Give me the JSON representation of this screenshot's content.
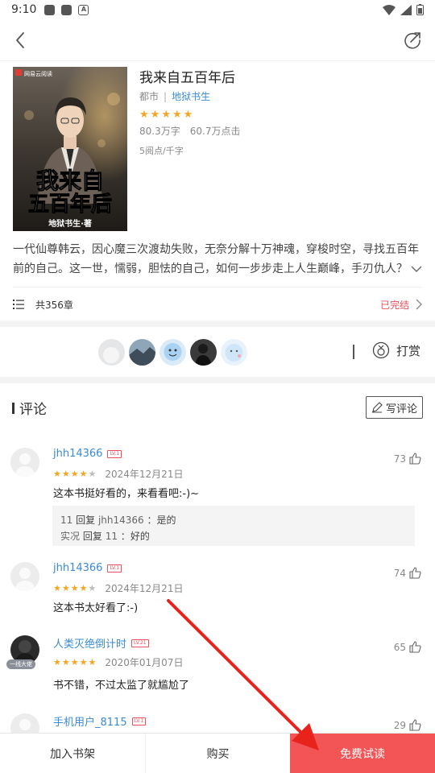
{
  "status_bar": {
    "time": "9:10"
  },
  "book": {
    "title": "我来自五百年后",
    "category": "都市",
    "author": "地狱书生",
    "rating_stars": 5,
    "word_count": "80.3万字",
    "clicks": "60.7万点击",
    "price": "5阅点/千字",
    "cover": {
      "publisher": "网易云阅读",
      "title_line1": "我来自",
      "title_line2": "五百年后",
      "author_credit": "地狱书生·著"
    },
    "intro": "一代仙尊韩云，因心魔三次渡劫失败，无奈分解十万神魂，穿梭时空，寻找五百年前的自己。这一世，懦弱，胆怯的自己，如何一步步走上人生巅峰，手刃仇人？",
    "chapters": "共356章",
    "status": "已完结"
  },
  "rewards": {
    "label": "打赏"
  },
  "comments_section": {
    "title": "评论",
    "write_label": "写评论",
    "items": [
      {
        "user": "jhh14366",
        "level": "LV.1",
        "stars": 4,
        "date": "2024年12月21日",
        "text": "这本书挺好看的，来看看吧:-)~",
        "likes": "73",
        "replies": [
          {
            "from": "11",
            "verb": "回复",
            "to": "jhh14366",
            "text": "是的"
          },
          {
            "from": "实况",
            "verb": "回复",
            "to": "11",
            "text": "好的"
          }
        ]
      },
      {
        "user": "jhh14366",
        "level": "LV.1",
        "stars": 4,
        "date": "2024年12月21日",
        "text": "这本书太好看了:-)",
        "likes": "74"
      },
      {
        "user": "人类灭绝倒计时",
        "level": "LV.21",
        "stars": 5,
        "date": "2020年01月07日",
        "text": "书不错，不过太监了就尴尬了",
        "likes": "65",
        "badge": "一线大佬"
      },
      {
        "user": "手机用户_8115",
        "level": "LV.1",
        "likes": "29"
      }
    ]
  },
  "bottom_bar": {
    "add_shelf": "加入书架",
    "buy": "购买",
    "free_trial": "免费试读"
  },
  "colors": {
    "accent_red": "#f35456",
    "link_blue": "#3a8bd6",
    "star": "#f4a623"
  }
}
